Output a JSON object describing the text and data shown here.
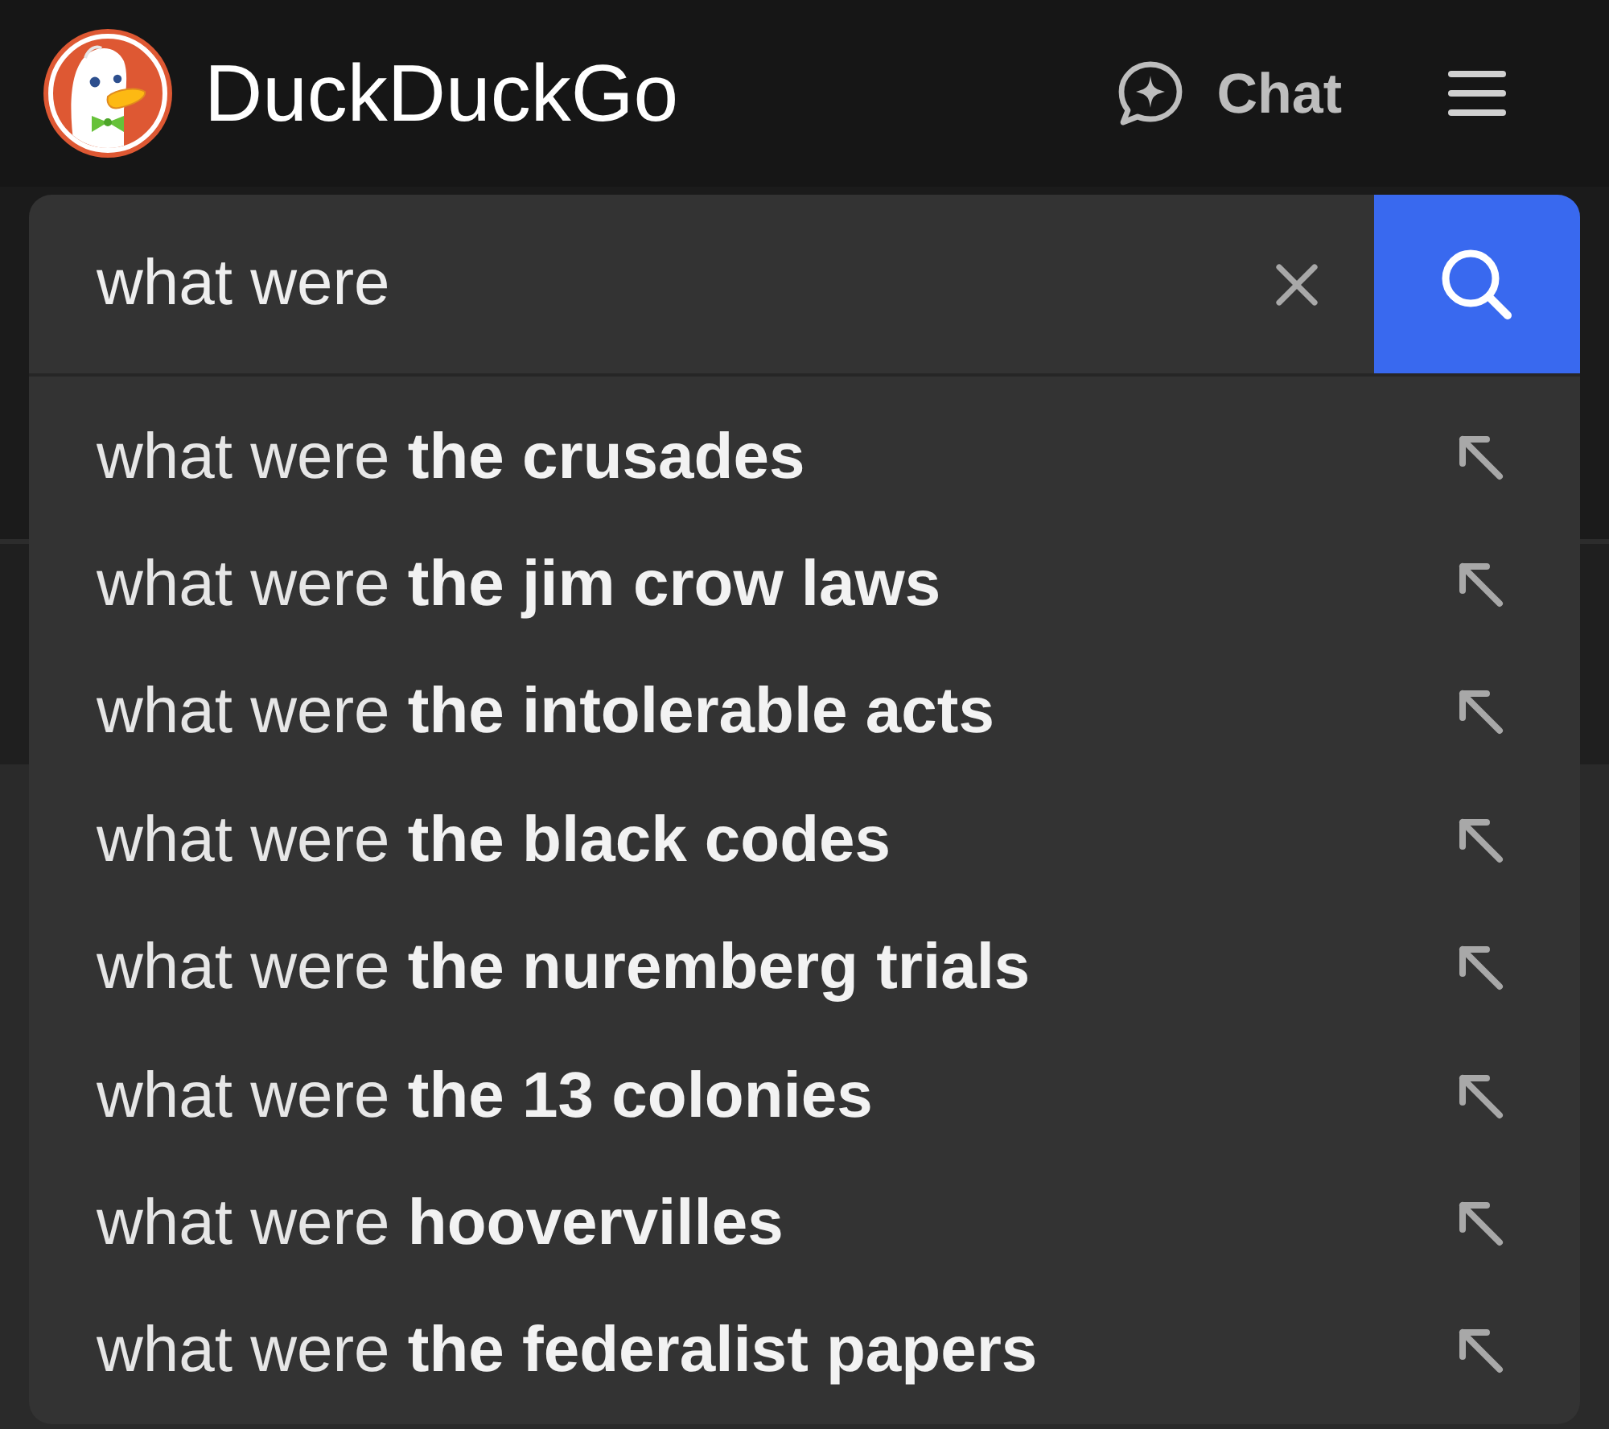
{
  "header": {
    "logo_text": "DuckDuckGo",
    "chat_label": "Chat"
  },
  "search": {
    "value": "what were"
  },
  "suggestions": [
    {
      "text": "what were **the crusades**"
    },
    {
      "text": "what were **the jim crow laws**"
    },
    {
      "text": "what were **the intolerable acts**"
    },
    {
      "text": "what were **the black codes**"
    },
    {
      "text": "what were **the nuremberg trials**"
    },
    {
      "text": "what were **the 13 colonies**"
    },
    {
      "text": "what were **hoovervilles**"
    },
    {
      "text": "what were **the federalist papers**"
    }
  ]
}
